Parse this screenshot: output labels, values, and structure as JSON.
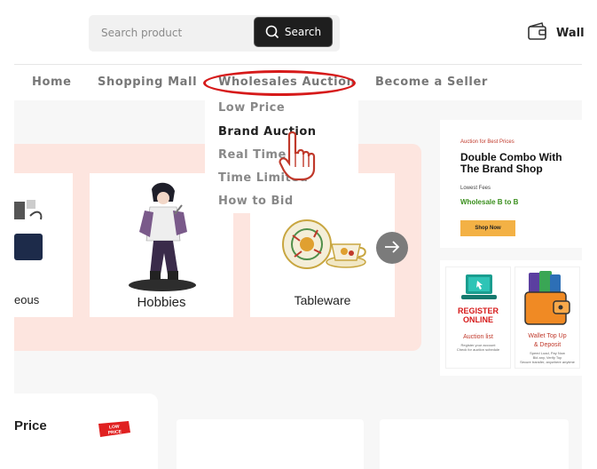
{
  "header": {
    "search": {
      "placeholder": "Search product",
      "button_label": "Search"
    },
    "wallet_label": "Wall"
  },
  "nav": {
    "items": [
      {
        "label": "Home"
      },
      {
        "label": "Shopping Mall"
      },
      {
        "label": "Wholesales Auction",
        "highlighted": true
      },
      {
        "label": "Become a Seller"
      }
    ],
    "dropdown": {
      "items": [
        {
          "label": "Low Price"
        },
        {
          "label": "Brand Auction",
          "active": true
        },
        {
          "label": "Real Time"
        },
        {
          "label": "Time Limited"
        },
        {
          "label": "How to Bid"
        }
      ]
    }
  },
  "categories": {
    "items": [
      {
        "label": "eous"
      },
      {
        "label": "Hobbies"
      },
      {
        "label": "Tableware"
      }
    ]
  },
  "promo": {
    "tagline": "Auction for Best Prices",
    "title_line1": "Double Combo With",
    "title_line2": "The Brand Shop",
    "sub": "Lowest Fees",
    "wholesale": "Wholesale B to B",
    "cta": "Shop Now"
  },
  "tiles": [
    {
      "title_line1": "REGISTER",
      "title_line2": "ONLINE",
      "caption": "Auction list",
      "fine_print_1": "Register your account",
      "fine_print_2": "Check for auction schedule"
    },
    {
      "title_line1": "Wallet Top Up",
      "title_line2": "& Deposit",
      "caption": "",
      "fine_print_1": "Speed Load, Pay Now",
      "fine_print_2": "Bid any, Verify Top",
      "fine_print_3": "Secure transfer, anywhere anytime"
    }
  ],
  "price_section": {
    "label": "Price",
    "badge_line1": "LOW",
    "badge_line2": "PRICE"
  },
  "colors": {
    "accent_red": "#d61a1a",
    "panel_pink": "#fde5df",
    "dark": "#1e1e1e",
    "green": "#3a8f1d",
    "orange": "#f3b145"
  }
}
